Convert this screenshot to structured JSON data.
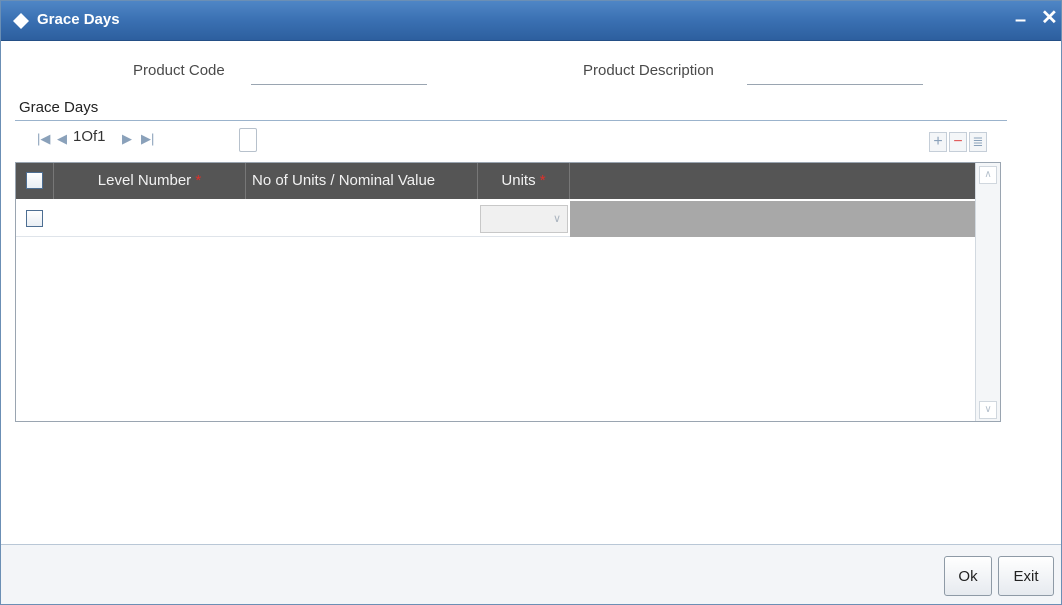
{
  "window": {
    "title": "Grace Days",
    "minimize_glyph": "–",
    "close_glyph": "✕"
  },
  "fields": {
    "product_code_label": "Product Code",
    "product_code_value": "",
    "product_description_label": "Product Description",
    "product_description_value": ""
  },
  "section": {
    "title": "Grace Days"
  },
  "pager": {
    "first": "|◀",
    "prev": "◀",
    "page_text": "1Of1",
    "next": "▶",
    "last": "▶|",
    "page_input": ""
  },
  "toolbar": {
    "add": "+",
    "remove": "−",
    "view": "≣"
  },
  "grid": {
    "columns": [
      {
        "label": "Level Number",
        "required": "*"
      },
      {
        "label": "No of Units / Nominal Value",
        "required": ""
      },
      {
        "label": "Units",
        "required": "*"
      }
    ],
    "rows": [
      {
        "level_number": "",
        "no_of_units": "",
        "units": ""
      }
    ]
  },
  "footer": {
    "ok_label": "Ok",
    "exit_label": "Exit"
  },
  "colors": {
    "titlebar": "#3a70b2",
    "header": "#555555",
    "required": "#e0302a"
  }
}
